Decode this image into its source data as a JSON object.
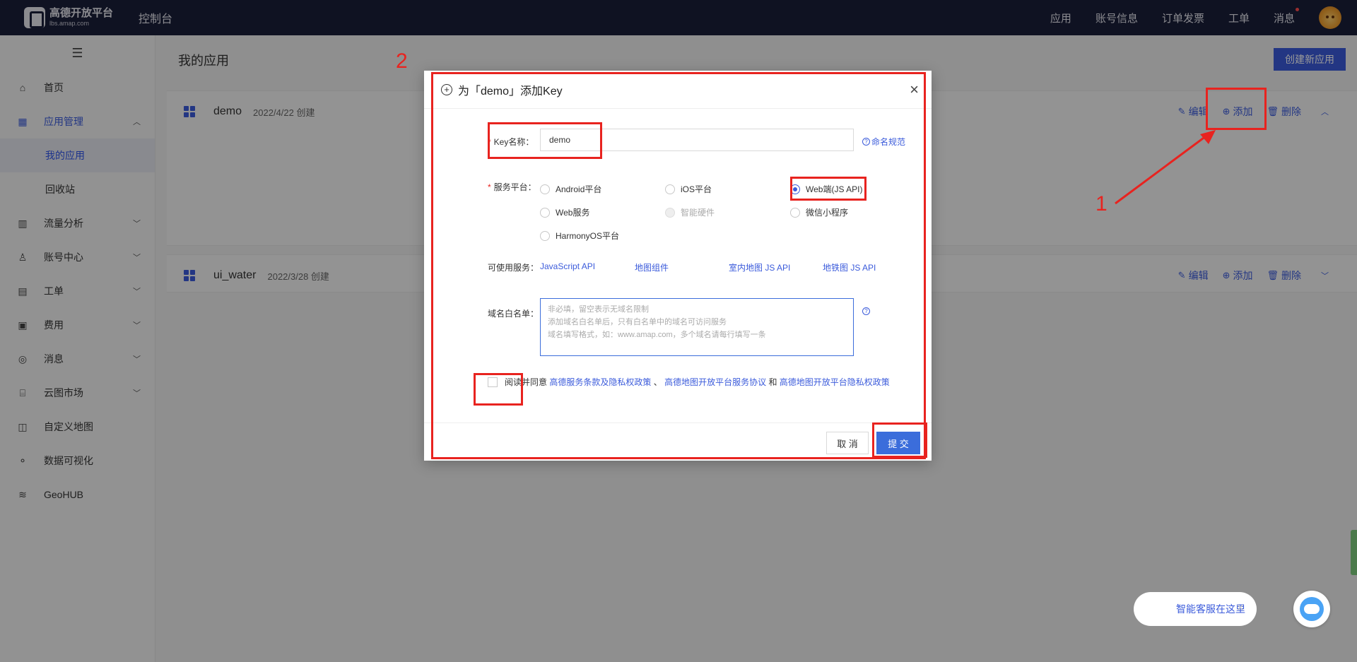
{
  "topbar": {
    "logo_title": "高德开放平台",
    "logo_sub": "lbs.amap.com",
    "console": "控制台",
    "nav": [
      "应用",
      "账号信息",
      "订单发票",
      "工单",
      "消息"
    ]
  },
  "sidebar": {
    "toggle": "☰",
    "items": [
      {
        "label": "首页",
        "icon": "home-icon"
      },
      {
        "label": "应用管理",
        "icon": "apps-icon",
        "sub": [
          "我的应用",
          "回收站"
        ]
      },
      {
        "label": "流量分析",
        "icon": "chart-icon"
      },
      {
        "label": "账号中心",
        "icon": "user-icon"
      },
      {
        "label": "工单",
        "icon": "ticket-icon"
      },
      {
        "label": "费用",
        "icon": "billing-icon"
      },
      {
        "label": "消息",
        "icon": "message-icon"
      },
      {
        "label": "云图市场",
        "icon": "store-icon"
      },
      {
        "label": "自定义地图",
        "icon": "map-icon"
      },
      {
        "label": "数据可视化",
        "icon": "visual-icon"
      },
      {
        "label": "GeoHUB",
        "icon": "layers-icon"
      }
    ]
  },
  "main": {
    "title": "我的应用",
    "create_btn": "创建新应用",
    "apps": [
      {
        "name": "demo",
        "date": "2022/4/22 创建"
      },
      {
        "name": "ui_water",
        "date": "2022/3/28 创建"
      }
    ],
    "actions": {
      "edit": "编辑",
      "add": "添加",
      "delete": "删除"
    }
  },
  "modal": {
    "title": "为「demo」添加Key",
    "key_label": "Key名称：",
    "key_value": "demo",
    "naming_link": "命名规范",
    "platform_label": "服务平台：",
    "platforms": [
      "Android平台",
      "iOS平台",
      "Web端(JS API)",
      "Web服务",
      "智能硬件",
      "微信小程序",
      "HarmonyOS平台"
    ],
    "selected_platform": "Web端(JS API)",
    "services_label": "可使用服务：",
    "services": [
      "JavaScript API",
      "地图组件",
      "室内地图 JS API",
      "地铁图 JS API"
    ],
    "whitelist_label": "域名白名单：",
    "whitelist_placeholder": [
      "非必填，留空表示无域名限制",
      "添加域名白名单后，只有白名单中的域名可访问服务",
      "域名填写格式，如：www.amap.com，多个域名请每行填写一条"
    ],
    "agree_prefix": "阅读并同意",
    "agree_links": [
      "高德服务条款及隐私权政策",
      "高德地图开放平台服务协议",
      "高德地图开放平台隐私权政策"
    ],
    "agree_sep1": "、",
    "agree_sep2": "和",
    "cancel": "取 消",
    "submit": "提 交"
  },
  "annotations": {
    "step1": "1",
    "step2": "2",
    "color": "#e8231f"
  },
  "chat": {
    "label": "智能客服在这里",
    "close": "×"
  },
  "colors": {
    "primary": "#3b5bdb",
    "topbar": "#1a1e3a"
  }
}
